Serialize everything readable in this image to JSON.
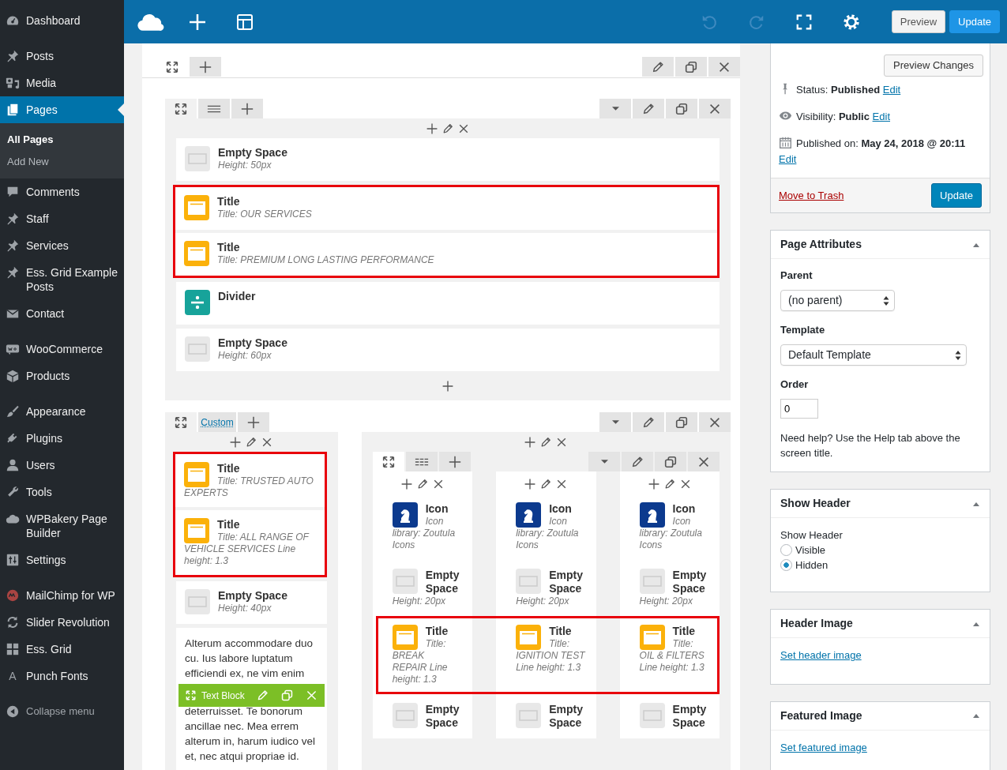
{
  "sidebar": {
    "groups": [
      [
        {
          "label": "Dashboard",
          "selected": false
        }
      ],
      [
        {
          "label": "Posts",
          "selected": false
        },
        {
          "label": "Media",
          "selected": false
        },
        {
          "label": "Pages",
          "selected": true,
          "children": [
            {
              "label": "All Pages",
              "selected": true
            },
            {
              "label": "Add New",
              "selected": false
            }
          ]
        },
        {
          "label": "Comments",
          "selected": false
        },
        {
          "label": "Staff",
          "selected": false
        },
        {
          "label": "Services",
          "selected": false
        },
        {
          "label": "Ess. Grid Example Posts",
          "selected": false
        },
        {
          "label": "Contact",
          "selected": false
        }
      ],
      [
        {
          "label": "WooCommerce",
          "selected": false
        },
        {
          "label": "Products",
          "selected": false
        }
      ],
      [
        {
          "label": "Appearance",
          "selected": false
        },
        {
          "label": "Plugins",
          "selected": false
        },
        {
          "label": "Users",
          "selected": false
        },
        {
          "label": "Tools",
          "selected": false
        },
        {
          "label": "WPBakery Page Builder",
          "selected": false
        },
        {
          "label": "Settings",
          "selected": false
        }
      ],
      [
        {
          "label": "MailChimp for WP",
          "selected": false
        },
        {
          "label": "Slider Revolution",
          "selected": false
        },
        {
          "label": "Ess. Grid",
          "selected": false
        },
        {
          "label": "Punch Fonts",
          "selected": false,
          "glyph": "A"
        }
      ]
    ],
    "collapse": "Collapse menu"
  },
  "topbar": {
    "history": [
      {
        "kind": "undo",
        "disabled": true
      },
      {
        "kind": "redo",
        "disabled": true
      }
    ],
    "buttons": [
      {
        "label": "Preview",
        "kind": "secondary"
      },
      {
        "label": "Update",
        "kind": "primary"
      }
    ]
  },
  "builder": {
    "rows": [
      {
        "columns": [
          {
            "footer_add": true,
            "elements": [
              {
                "kind": "empty_space",
                "name": "Empty Space",
                "detail": "Height: 50px",
                "highlighted": false
              },
              {
                "kind": "title",
                "name": "Title",
                "detail": "Title: OUR SERVICES",
                "highlighted": true
              },
              {
                "kind": "title",
                "name": "Title",
                "detail": "Title: PREMIUM LONG LASTING PERFORMANCE",
                "highlighted": true
              },
              {
                "kind": "divider",
                "name": "Divider",
                "highlighted": false
              },
              {
                "kind": "empty_space",
                "name": "Empty Space",
                "detail": "Height: 60px",
                "highlighted": false
              }
            ]
          }
        ]
      },
      {
        "layout_label": "Custom",
        "columns": [
          {
            "elements": [
              {
                "kind": "title",
                "name": "Title",
                "detail": "Title: TRUSTED AUTO EXPERTS",
                "highlighted": true
              },
              {
                "kind": "title",
                "name": "Title",
                "detail": "Title: ALL RANGE OF VEHICLE SERVICES Line height: 1.3",
                "highlighted": true
              },
              {
                "kind": "empty_space",
                "name": "Empty Space",
                "detail": "Height: 40px",
                "highlighted": false
              },
              {
                "kind": "text_block",
                "label": "Text Block",
                "text_above": "Alterum accommodare duo cu. Ius labore luptatum efficiendi ex, ne vim enim",
                "text_below": "deterruisset. Te bonorum ancillae nec. Mea errem alterum in, harum iudico vel et, nec atqui propriae id.",
                "highlighted": false
              }
            ]
          },
          {
            "inner_row": {
              "columns": [
                {
                  "elements": [
                    {
                      "kind": "icon",
                      "name": "Icon",
                      "detail": "Icon library: Zoutula Icons",
                      "highlighted": false
                    },
                    {
                      "kind": "empty_space",
                      "name": "Empty Space",
                      "detail": "Height: 20px",
                      "highlighted": false
                    },
                    {
                      "kind": "title",
                      "name": "Title",
                      "detail": "Title: BREAK REPAIR Line height: 1.3",
                      "highlighted": true
                    },
                    {
                      "kind": "empty_space",
                      "name": "Empty Space",
                      "highlighted": false
                    }
                  ]
                },
                {
                  "elements": [
                    {
                      "kind": "icon",
                      "name": "Icon",
                      "detail": "Icon library: Zoutula Icons",
                      "highlighted": false
                    },
                    {
                      "kind": "empty_space",
                      "name": "Empty Space",
                      "detail": "Height: 20px",
                      "highlighted": false
                    },
                    {
                      "kind": "title",
                      "name": "Title",
                      "detail": "Title: IGNITION TEST Line height: 1.3",
                      "highlighted": true
                    },
                    {
                      "kind": "empty_space",
                      "name": "Empty Space",
                      "highlighted": false
                    }
                  ]
                },
                {
                  "elements": [
                    {
                      "kind": "icon",
                      "name": "Icon",
                      "detail": "Icon library: Zoutula Icons",
                      "highlighted": false
                    },
                    {
                      "kind": "empty_space",
                      "name": "Empty Space",
                      "detail": "Height: 20px",
                      "highlighted": false
                    },
                    {
                      "kind": "title",
                      "name": "Title",
                      "detail": "Title: OIL & FILTERS Line height: 1.3",
                      "highlighted": true
                    },
                    {
                      "kind": "empty_space",
                      "name": "Empty Space",
                      "highlighted": false
                    }
                  ]
                }
              ]
            }
          }
        ]
      }
    ]
  },
  "metaboxes": [
    {
      "kind": "publish",
      "preview": "Preview Changes",
      "meta": [
        {
          "label": "Status:",
          "value": "Published",
          "link": "Edit"
        },
        {
          "label": "Visibility:",
          "value": "Public",
          "link": "Edit"
        },
        {
          "label": "Published on:",
          "value": "May 24, 2018 @ 20:11",
          "link": "Edit"
        }
      ],
      "trash": "Move to Trash",
      "update": "Update"
    },
    {
      "kind": "attributes",
      "title": "Page Attributes",
      "expanded": true,
      "fields": [
        {
          "kind": "dropdown",
          "label": "Parent",
          "value": "(no parent)"
        },
        {
          "kind": "wide_dropdown",
          "label": "Template",
          "value": "Default Template"
        },
        {
          "kind": "input",
          "label": "Order",
          "value": "0"
        }
      ],
      "help": "Need help? Use the Help tab above the screen title."
    },
    {
      "kind": "radios",
      "title": "Show Header",
      "expanded": true,
      "label": "Show Header",
      "options": [
        {
          "label": "Visible",
          "selected": false
        },
        {
          "label": "Hidden",
          "selected": true
        }
      ]
    },
    {
      "kind": "link",
      "title": "Header Image",
      "expanded": true,
      "link": "Set header image"
    },
    {
      "kind": "link",
      "title": "Featured Image",
      "expanded": true,
      "link": "Set featured image"
    }
  ]
}
